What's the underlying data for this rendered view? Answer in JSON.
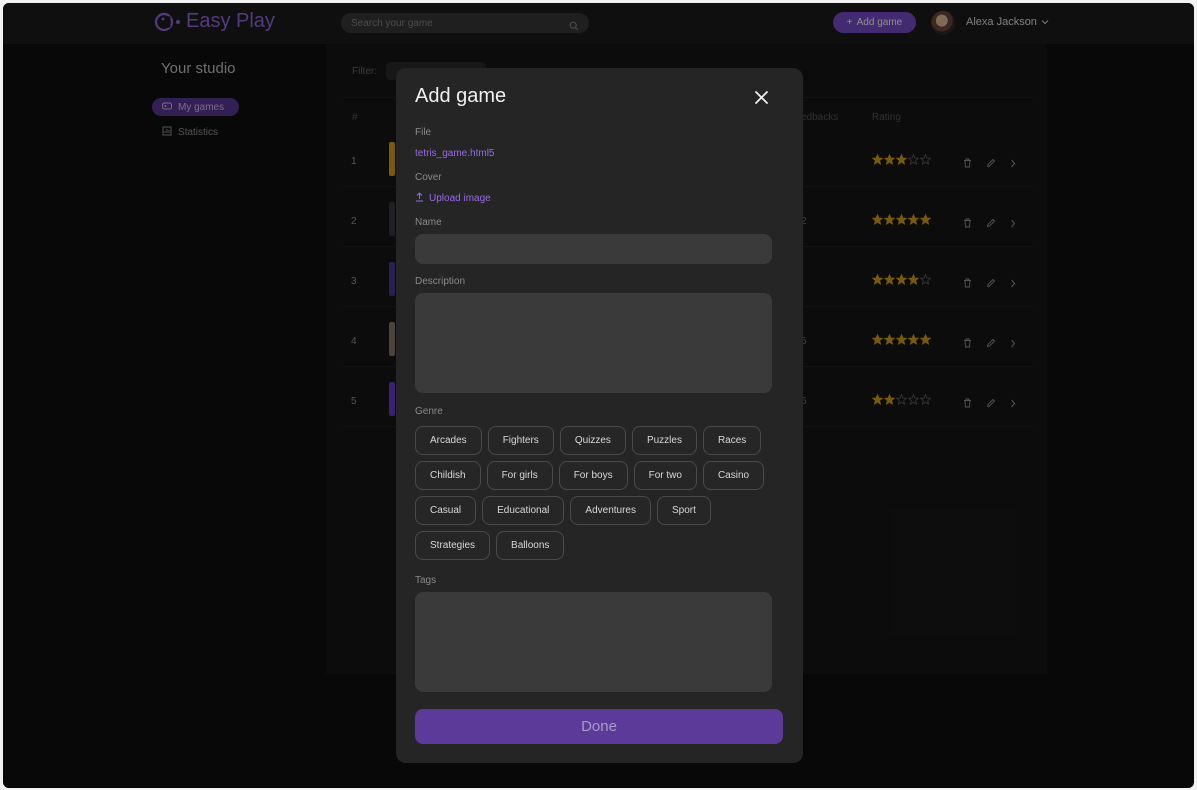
{
  "header": {
    "brand": "Easy Play",
    "search_placeholder": "Search your game",
    "add_game": "Add game",
    "user_name": "Alexa Jackson"
  },
  "sidebar": {
    "title": "Your studio",
    "items": [
      {
        "label": "My games",
        "icon": "gamepad-icon",
        "active": true
      },
      {
        "label": "Statistics",
        "icon": "stats-icon",
        "active": false
      }
    ]
  },
  "games_panel": {
    "filter_label": "Filter:",
    "columns": {
      "num": "#",
      "feedbacks_partial": "edbacks",
      "rating": "Rating"
    },
    "rows": [
      {
        "num": "1",
        "feedbacks_partial": "",
        "rating": 3
      },
      {
        "num": "2",
        "feedbacks_partial": "2",
        "rating": 5
      },
      {
        "num": "3",
        "feedbacks_partial": "",
        "rating": 4
      },
      {
        "num": "4",
        "feedbacks_partial": "5",
        "rating": 5
      },
      {
        "num": "5",
        "feedbacks_partial": "6",
        "rating": 2
      }
    ]
  },
  "modal": {
    "title": "Add game",
    "file_label": "File",
    "file_value": "tetris_game.html5",
    "cover_label": "Cover",
    "upload_label": "Upload image",
    "name_label": "Name",
    "description_label": "Description",
    "genre_label": "Genre",
    "genres": [
      [
        "Arcades",
        "Fighters",
        "Quizzes",
        "Puzzles",
        "Races"
      ],
      [
        "Childish",
        "For girls",
        "For boys",
        "For two",
        "Casino"
      ],
      [
        "Casual",
        "Educational",
        "Adventures",
        "Sport"
      ],
      [
        "Strategies",
        "Balloons"
      ]
    ],
    "tags_label": "Tags",
    "done_label": "Done"
  },
  "colors": {
    "accent": "#7b4fd0",
    "accent_text": "#9a6ae6",
    "star": "#d9a514",
    "background": "#0f0f0f",
    "modal": "#252525"
  }
}
